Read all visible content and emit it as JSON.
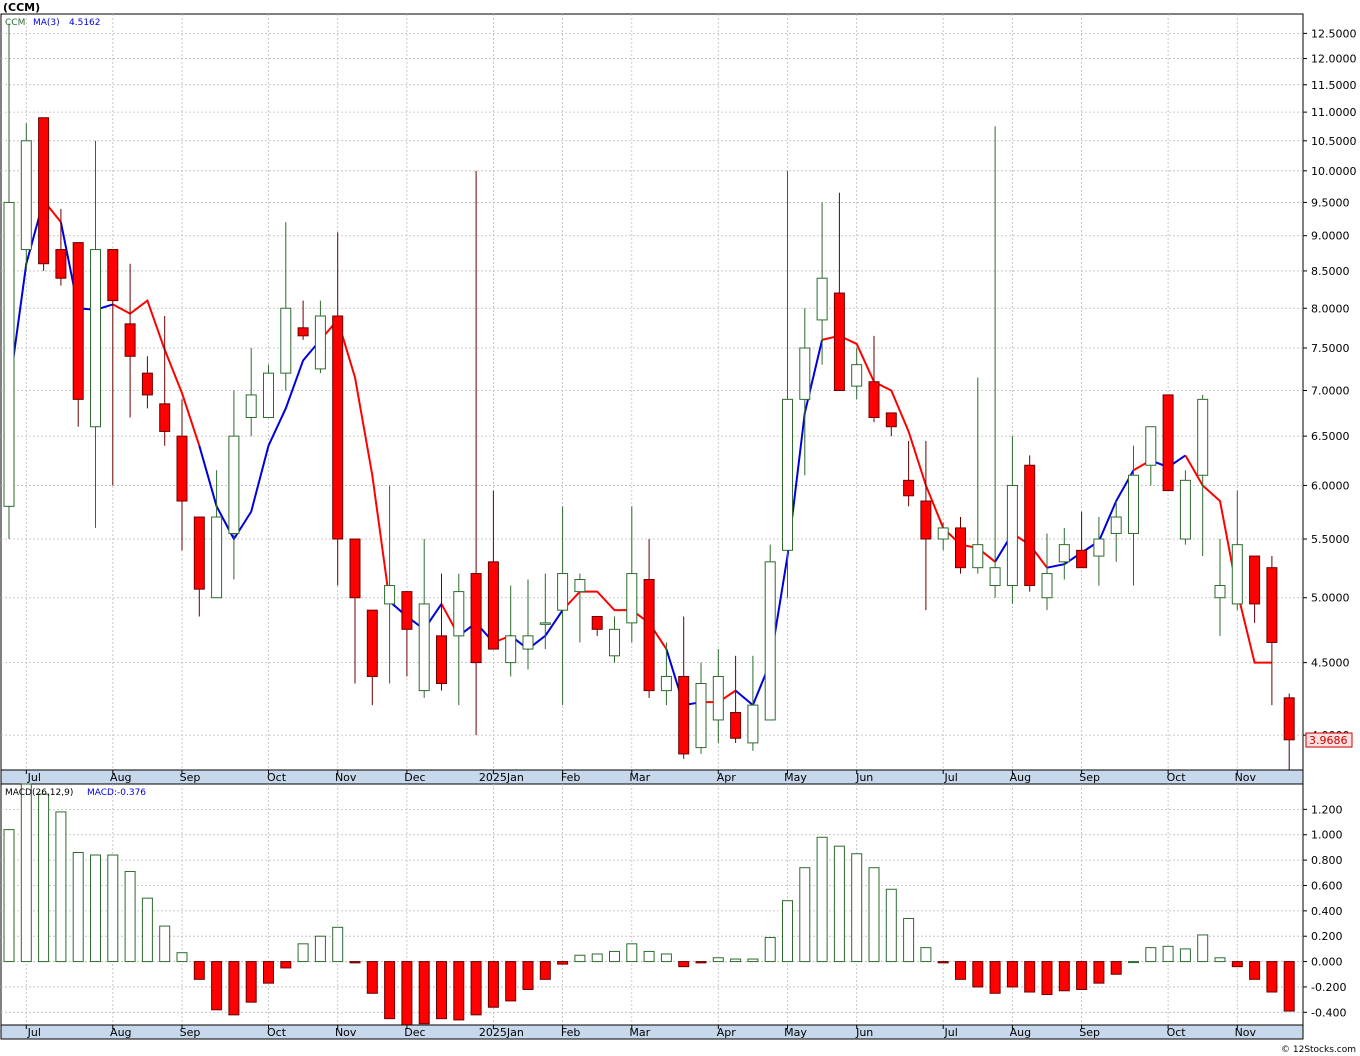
{
  "header": {
    "symbol": "(CCM)",
    "legend_ticker": "CCM",
    "legend_ma_label": "MA(3)",
    "legend_ma_value": "4.5162"
  },
  "macd_header": {
    "label": "MACD(26,12,9)",
    "value_label": "MACD:-0.376"
  },
  "footer": {
    "credit": "© 12Stocks.com"
  },
  "colors": {
    "up_body": "#ffffff",
    "up_outline": "#2e6b2e",
    "down_body": "#ff0000",
    "down_outline": "#6b0000",
    "ma_up": "#0000dd",
    "ma_down": "#ff0000",
    "grid": "#bbbbbb",
    "axis_band": "#c8d8ec",
    "last_price_bg": "#fde0e0"
  },
  "chart_data": [
    {
      "type": "candlestick",
      "title": "(CCM)",
      "y_scale": "log",
      "ylim": [
        3.78,
        12.9
      ],
      "y_ticks": [
        "12.5000",
        "12.0000",
        "11.5000",
        "11.0000",
        "10.5000",
        "10.0000",
        "9.5000",
        "9.0000",
        "8.5000",
        "8.0000",
        "7.5000",
        "7.0000",
        "6.5000",
        "6.0000",
        "5.5000",
        "5.0000",
        "4.5000",
        "4.0000"
      ],
      "last_price": "3.9686",
      "x_ticks": [
        {
          "label": "Jul",
          "index": 1
        },
        {
          "label": "Aug",
          "index": 6
        },
        {
          "label": "Sep",
          "index": 10
        },
        {
          "label": "Oct",
          "index": 15
        },
        {
          "label": "Nov",
          "index": 19
        },
        {
          "label": "Dec",
          "index": 23
        },
        {
          "label": "2025Jan",
          "index": 28
        },
        {
          "label": "Feb",
          "index": 32
        },
        {
          "label": "Mar",
          "index": 36
        },
        {
          "label": "Apr",
          "index": 41
        },
        {
          "label": "May",
          "index": 45
        },
        {
          "label": "Jun",
          "index": 49
        },
        {
          "label": "Jul",
          "index": 54
        },
        {
          "label": "Aug",
          "index": 58
        },
        {
          "label": "Sep",
          "index": 62
        },
        {
          "label": "Oct",
          "index": 67
        },
        {
          "label": "Nov",
          "index": 71
        }
      ],
      "candles": [
        {
          "o": 5.8,
          "h": 12.7,
          "l": 5.5,
          "c": 9.5
        },
        {
          "o": 8.8,
          "h": 10.8,
          "l": 8.5,
          "c": 10.5
        },
        {
          "o": 10.9,
          "h": 10.9,
          "l": 8.5,
          "c": 8.6
        },
        {
          "o": 8.8,
          "h": 9.4,
          "l": 8.3,
          "c": 8.4
        },
        {
          "o": 8.9,
          "h": 8.9,
          "l": 6.6,
          "c": 6.9
        },
        {
          "o": 6.6,
          "h": 10.5,
          "l": 5.6,
          "c": 8.8
        },
        {
          "o": 8.8,
          "h": 8.8,
          "l": 6.0,
          "c": 8.1
        },
        {
          "o": 7.8,
          "h": 8.6,
          "l": 6.7,
          "c": 7.4
        },
        {
          "o": 7.2,
          "h": 7.4,
          "l": 6.8,
          "c": 6.95
        },
        {
          "o": 6.85,
          "h": 7.9,
          "l": 6.4,
          "c": 6.55
        },
        {
          "o": 6.5,
          "h": 6.9,
          "l": 5.4,
          "c": 5.85
        },
        {
          "o": 5.7,
          "h": 5.7,
          "l": 4.85,
          "c": 5.07
        },
        {
          "o": 5.0,
          "h": 6.15,
          "l": 5.0,
          "c": 5.7
        },
        {
          "o": 5.55,
          "h": 7.0,
          "l": 5.15,
          "c": 6.5
        },
        {
          "o": 6.7,
          "h": 7.5,
          "l": 6.5,
          "c": 6.95
        },
        {
          "o": 6.7,
          "h": 7.3,
          "l": 7.0,
          "c": 7.2
        },
        {
          "o": 7.2,
          "h": 9.2,
          "l": 7.0,
          "c": 8.0
        },
        {
          "o": 7.75,
          "h": 8.1,
          "l": 7.6,
          "c": 7.65
        },
        {
          "o": 7.25,
          "h": 8.1,
          "l": 7.2,
          "c": 7.9
        },
        {
          "o": 7.9,
          "h": 9.05,
          "l": 5.1,
          "c": 5.5
        },
        {
          "o": 5.5,
          "h": 5.5,
          "l": 4.35,
          "c": 5.0
        },
        {
          "o": 4.9,
          "h": 4.9,
          "l": 4.2,
          "c": 4.4
        },
        {
          "o": 4.95,
          "h": 6.0,
          "l": 4.35,
          "c": 5.1
        },
        {
          "o": 5.05,
          "h": 5.05,
          "l": 4.4,
          "c": 4.75
        },
        {
          "o": 4.3,
          "h": 5.5,
          "l": 4.25,
          "c": 4.95
        },
        {
          "o": 4.7,
          "h": 5.2,
          "l": 4.3,
          "c": 4.35
        },
        {
          "o": 4.7,
          "h": 5.2,
          "l": 4.2,
          "c": 5.05
        },
        {
          "o": 5.2,
          "h": 10.0,
          "l": 4.0,
          "c": 4.5
        },
        {
          "o": 5.3,
          "h": 5.95,
          "l": 4.6,
          "c": 4.6
        },
        {
          "o": 4.5,
          "h": 5.1,
          "l": 4.4,
          "c": 4.7
        },
        {
          "o": 4.6,
          "h": 5.15,
          "l": 4.45,
          "c": 4.7
        },
        {
          "o": 4.8,
          "h": 5.2,
          "l": 4.6,
          "c": 4.8
        },
        {
          "o": 4.9,
          "h": 5.8,
          "l": 4.2,
          "c": 5.2
        },
        {
          "o": 5.05,
          "h": 5.2,
          "l": 4.65,
          "c": 5.15
        },
        {
          "o": 4.85,
          "h": 4.85,
          "l": 4.7,
          "c": 4.75
        },
        {
          "o": 4.55,
          "h": 4.85,
          "l": 4.5,
          "c": 4.75
        },
        {
          "o": 4.8,
          "h": 5.8,
          "l": 4.65,
          "c": 5.2
        },
        {
          "o": 5.15,
          "h": 5.5,
          "l": 4.25,
          "c": 4.3
        },
        {
          "o": 4.3,
          "h": 4.65,
          "l": 4.2,
          "c": 4.4
        },
        {
          "o": 4.4,
          "h": 4.85,
          "l": 3.85,
          "c": 3.88
        },
        {
          "o": 3.92,
          "h": 4.5,
          "l": 3.88,
          "c": 4.35
        },
        {
          "o": 4.1,
          "h": 4.6,
          "l": 3.95,
          "c": 4.4
        },
        {
          "o": 4.15,
          "h": 4.55,
          "l": 3.95,
          "c": 3.98
        },
        {
          "o": 3.95,
          "h": 4.55,
          "l": 3.9,
          "c": 4.2
        },
        {
          "o": 4.1,
          "h": 5.45,
          "l": 4.1,
          "c": 5.3
        },
        {
          "o": 5.4,
          "h": 10.0,
          "l": 5.0,
          "c": 6.9
        },
        {
          "o": 6.9,
          "h": 8.0,
          "l": 6.1,
          "c": 7.5
        },
        {
          "o": 7.85,
          "h": 9.5,
          "l": 7.3,
          "c": 8.4
        },
        {
          "o": 8.2,
          "h": 9.65,
          "l": 7.0,
          "c": 7.0
        },
        {
          "o": 7.05,
          "h": 7.5,
          "l": 6.9,
          "c": 7.3
        },
        {
          "o": 7.1,
          "h": 7.65,
          "l": 6.65,
          "c": 6.7
        },
        {
          "o": 6.75,
          "h": 6.75,
          "l": 6.5,
          "c": 6.6
        },
        {
          "o": 6.05,
          "h": 6.45,
          "l": 5.8,
          "c": 5.9
        },
        {
          "o": 5.85,
          "h": 6.45,
          "l": 4.9,
          "c": 5.5
        },
        {
          "o": 5.5,
          "h": 5.65,
          "l": 5.4,
          "c": 5.6
        },
        {
          "o": 5.6,
          "h": 5.7,
          "l": 5.2,
          "c": 5.25
        },
        {
          "o": 5.25,
          "h": 7.15,
          "l": 5.2,
          "c": 5.45
        },
        {
          "o": 5.1,
          "h": 10.75,
          "l": 5.0,
          "c": 5.25
        },
        {
          "o": 5.1,
          "h": 6.5,
          "l": 4.95,
          "c": 6.0
        },
        {
          "o": 6.2,
          "h": 6.3,
          "l": 5.05,
          "c": 5.1
        },
        {
          "o": 5.0,
          "h": 5.55,
          "l": 4.9,
          "c": 5.2
        },
        {
          "o": 5.3,
          "h": 5.6,
          "l": 5.15,
          "c": 5.45
        },
        {
          "o": 5.4,
          "h": 5.75,
          "l": 5.25,
          "c": 5.25
        },
        {
          "o": 5.35,
          "h": 5.7,
          "l": 5.1,
          "c": 5.5
        },
        {
          "o": 5.55,
          "h": 5.85,
          "l": 5.3,
          "c": 5.7
        },
        {
          "o": 5.55,
          "h": 6.4,
          "l": 5.1,
          "c": 6.1
        },
        {
          "o": 6.2,
          "h": 6.6,
          "l": 6.0,
          "c": 6.6
        },
        {
          "o": 6.95,
          "h": 6.95,
          "l": 6.0,
          "c": 5.95
        },
        {
          "o": 5.5,
          "h": 6.15,
          "l": 5.45,
          "c": 6.05
        },
        {
          "o": 6.1,
          "h": 6.95,
          "l": 5.35,
          "c": 6.9
        },
        {
          "o": 5.0,
          "h": 5.5,
          "l": 4.7,
          "c": 5.1
        },
        {
          "o": 4.95,
          "h": 5.95,
          "l": 4.9,
          "c": 5.45
        },
        {
          "o": 5.35,
          "h": 5.35,
          "l": 4.8,
          "c": 4.95
        },
        {
          "o": 5.25,
          "h": 5.35,
          "l": 4.2,
          "c": 4.65
        },
        {
          "o": 4.25,
          "h": 4.28,
          "l": 3.78,
          "c": 3.97
        }
      ],
      "ma": {
        "name": "MA(3)",
        "start_index": 0,
        "values": [
          7.0,
          8.6,
          9.53,
          9.2,
          8.0,
          7.98,
          8.05,
          7.93,
          8.1,
          7.48,
          6.97,
          6.4,
          5.8,
          5.5,
          5.75,
          6.4,
          6.8,
          7.35,
          7.6,
          7.85,
          7.15,
          6.1,
          4.97,
          4.85,
          4.75,
          4.95,
          4.7,
          4.8,
          4.65,
          4.7,
          4.6,
          4.7,
          4.9,
          5.05,
          5.05,
          4.9,
          4.9,
          4.8,
          4.6,
          4.2,
          4.22,
          4.22,
          4.3,
          4.2,
          4.5,
          5.35,
          6.75,
          7.6,
          7.65,
          7.55,
          7.1,
          7.0,
          6.55,
          6.0,
          5.6,
          5.45,
          5.42,
          5.3,
          5.55,
          5.45,
          5.25,
          5.28,
          5.38,
          5.48,
          5.85,
          6.15,
          6.25,
          6.18,
          6.3,
          6.0,
          5.85,
          5.05,
          4.5,
          4.5
        ],
        "segments": [
          {
            "from": 0,
            "to": 2,
            "dir": "up"
          },
          {
            "from": 2,
            "to": 3,
            "dir": "down"
          },
          {
            "from": 3,
            "to": 6,
            "dir": "up"
          },
          {
            "from": 6,
            "to": 11,
            "dir": "down"
          },
          {
            "from": 11,
            "to": 18,
            "dir": "up"
          },
          {
            "from": 18,
            "to": 22,
            "dir": "down"
          },
          {
            "from": 22,
            "to": 25,
            "dir": "up"
          },
          {
            "from": 25,
            "to": 26,
            "dir": "down"
          },
          {
            "from": 26,
            "to": 28,
            "dir": "up"
          },
          {
            "from": 28,
            "to": 29,
            "dir": "down"
          },
          {
            "from": 29,
            "to": 32,
            "dir": "up"
          },
          {
            "from": 32,
            "to": 38,
            "dir": "down"
          },
          {
            "from": 38,
            "to": 40,
            "dir": "up"
          },
          {
            "from": 40,
            "to": 42,
            "dir": "down"
          },
          {
            "from": 42,
            "to": 47,
            "dir": "up"
          },
          {
            "from": 47,
            "to": 57,
            "dir": "down"
          },
          {
            "from": 57,
            "to": 58,
            "dir": "up"
          },
          {
            "from": 58,
            "to": 60,
            "dir": "down"
          },
          {
            "from": 60,
            "to": 65,
            "dir": "up"
          },
          {
            "from": 65,
            "to": 66,
            "dir": "down"
          },
          {
            "from": 66,
            "to": 68,
            "dir": "up"
          },
          {
            "from": 68,
            "to": 73,
            "dir": "down"
          }
        ]
      }
    },
    {
      "type": "bar",
      "title": "MACD(26,12,9)",
      "ylim": [
        -0.5,
        1.4
      ],
      "y_ticks": [
        "1.200",
        "1.000",
        "0.800",
        "0.600",
        "0.400",
        "0.200",
        "0.000",
        "-0.200",
        "-0.400"
      ],
      "values": [
        1.04,
        1.4,
        1.32,
        1.18,
        0.86,
        0.84,
        0.84,
        0.71,
        0.5,
        0.28,
        0.07,
        -0.14,
        -0.38,
        -0.42,
        -0.32,
        -0.17,
        -0.05,
        0.14,
        0.2,
        0.27,
        -0.01,
        -0.25,
        -0.45,
        -0.5,
        -0.49,
        -0.45,
        -0.46,
        -0.42,
        -0.36,
        -0.31,
        -0.22,
        -0.14,
        -0.02,
        0.05,
        0.06,
        0.08,
        0.14,
        0.08,
        0.06,
        -0.04,
        -0.01,
        0.03,
        0.02,
        0.02,
        0.19,
        0.48,
        0.74,
        0.98,
        0.91,
        0.85,
        0.74,
        0.57,
        0.34,
        0.11,
        -0.01,
        -0.14,
        -0.2,
        -0.25,
        -0.2,
        -0.24,
        -0.26,
        -0.23,
        -0.22,
        -0.17,
        -0.1,
        0.0,
        0.11,
        0.12,
        0.1,
        0.21,
        0.03,
        -0.04,
        -0.14,
        -0.24,
        -0.39
      ]
    }
  ]
}
